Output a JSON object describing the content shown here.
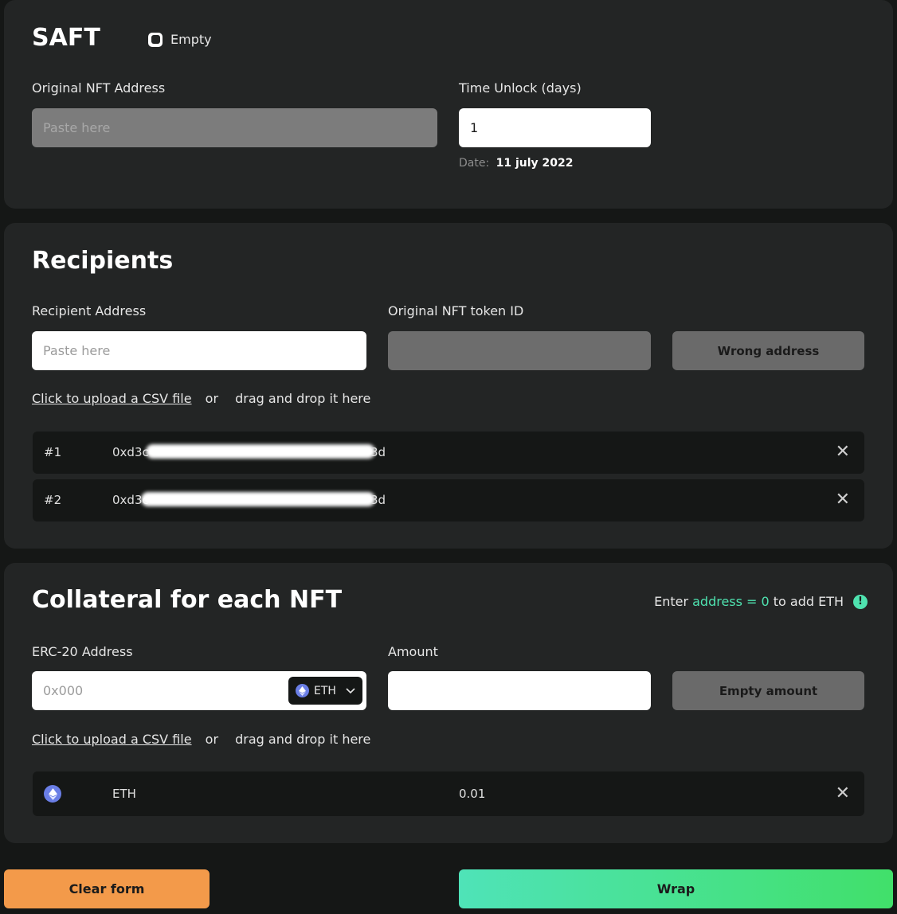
{
  "saft": {
    "title": "SAFT",
    "empty_label": "Empty",
    "original_nft_label": "Original NFT Address",
    "original_nft_placeholder": "Paste here",
    "time_unlock_label": "Time Unlock (days)",
    "time_unlock_value": "1",
    "date_label": "Date:",
    "date_value": "11 july 2022"
  },
  "recipients": {
    "title": "Recipients",
    "recipient_address_label": "Recipient Address",
    "recipient_address_placeholder": "Paste here",
    "token_id_label": "Original NFT token ID",
    "wrong_address_button": "Wrong address",
    "csv_link": "Click to upload a CSV file",
    "csv_or": "or",
    "csv_drag": "drag and drop it here",
    "list": [
      {
        "index": "#1",
        "address_start": "0xd3c",
        "address_end": "3d"
      },
      {
        "index": "#2",
        "address_start": "0xd3c",
        "address_end": "3d"
      }
    ]
  },
  "collateral": {
    "title": "Collateral for each NFT",
    "hint_prefix": "Enter",
    "hint_highlight": "address = 0",
    "hint_suffix": "to add ETH",
    "hint_icon": "!",
    "erc20_label": "ERC-20 Address",
    "erc20_placeholder": "0x000",
    "token_select": "ETH",
    "amount_label": "Amount",
    "empty_amount_button": "Empty amount",
    "csv_link": "Click to upload a CSV file",
    "csv_or": "or",
    "csv_drag": "drag and drop it here",
    "list": [
      {
        "token": "ETH",
        "amount": "0.01"
      }
    ]
  },
  "footer": {
    "clear_button": "Clear form",
    "wrap_button": "Wrap"
  },
  "colors": {
    "accent_green": "#4fe3b0",
    "clear_orange": "#f39a4a",
    "eth_blue": "#6a7ee6"
  },
  "icons": [
    "eth-icon",
    "chevron-down-icon",
    "close-icon",
    "info-icon",
    "checkbox-icon"
  ]
}
